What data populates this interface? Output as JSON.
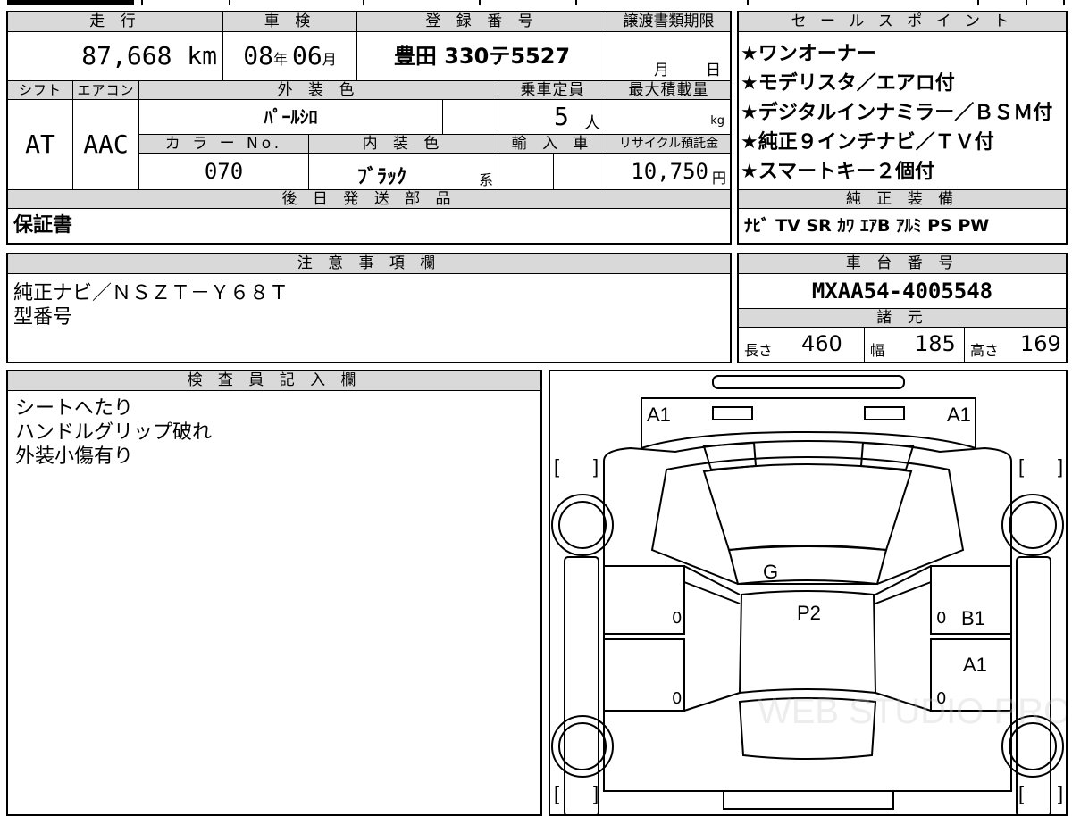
{
  "vehicle": {
    "mileage_label": "走 行",
    "mileage_value": "87,668 km",
    "inspection_label": "車 検",
    "inspection_year": "08",
    "inspection_year_unit": "年",
    "inspection_month": "06",
    "inspection_month_unit": "月",
    "registration_label": "登 録 番 号",
    "registration_value": "豊田 330テ5527",
    "transfer_label": "譲渡書類期限",
    "transfer_month_unit": "月",
    "transfer_day_unit": "日",
    "shift_label": "シフト",
    "shift_value": "AT",
    "ac_label": "エアコン",
    "ac_value": "AAC",
    "exterior_color_label": "外 装 色",
    "exterior_color_value": "ﾊﾟｰﾙｼﾛ",
    "capacity_label": "乗車定員",
    "capacity_value": "5",
    "capacity_unit": "人",
    "max_load_label": "最大積載量",
    "max_load_unit": "kg",
    "color_no_label": "カ ラ ー No.",
    "color_no_value": "070",
    "interior_color_label": "内 装 色",
    "interior_color_value": "ﾌﾞﾗｯｸ",
    "interior_color_suffix": "系",
    "import_label": "輸 入 車",
    "recycle_label": "リサイクル預託金",
    "recycle_value": "10,750",
    "recycle_unit": "円"
  },
  "sales_points": {
    "title": "セ ー ル ス ポ イ ン ト",
    "items": [
      "★ワンオーナー",
      "★モデリスタ／エアロ付",
      "★デジタルインナミラー／ＢＳＭ付",
      "★純正９インチナビ／ＴＶ付",
      "★スマートキー２個付"
    ]
  },
  "later_parts": {
    "title": "後 日 発 送 部 品",
    "value": "保証書"
  },
  "equipment": {
    "title": "純 正 装 備",
    "value": "ﾅﾋﾞ TV SR ｶﾜ ｴｱB ｱﾙﾐ PS PW"
  },
  "notes": {
    "title": "注 意 事 項 欄",
    "lines": [
      "純正ナビ／ＮＳＺＴ－Ｙ６８Ｔ",
      "型番号"
    ]
  },
  "chassis": {
    "title": "車 台 番 号",
    "value": "MXAA54-4005548"
  },
  "specs": {
    "title": "諸 元",
    "length_label": "長さ",
    "length_value": "460",
    "width_label": "幅",
    "width_value": "185",
    "height_label": "高さ",
    "height_value": "169"
  },
  "inspector": {
    "title": "検 査 員 記 入 欄",
    "lines": [
      "シートへたり",
      "ハンドルグリップ破れ",
      "外装小傷有り"
    ]
  },
  "diagram": {
    "marks": {
      "front_left": "A1",
      "front_right": "A1",
      "bonnet": "G",
      "roof": "P2",
      "right_front_door": "B1",
      "right_rear_door": "A1",
      "door_zero_1": "0",
      "door_zero_2": "0",
      "door_zero_3": "0",
      "door_zero_4": "0"
    },
    "bracket_left": "[",
    "bracket_right": "]",
    "watermark": "WEB STUDIO PRO"
  }
}
